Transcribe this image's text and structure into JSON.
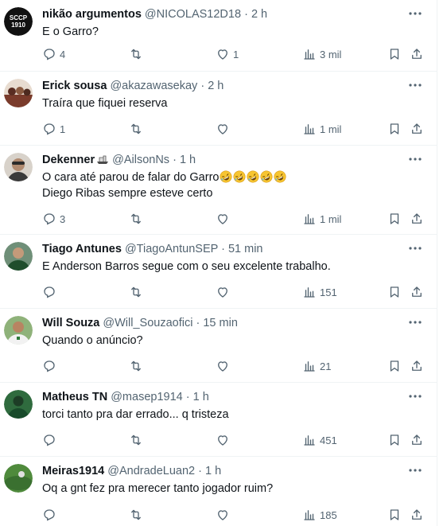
{
  "tweets": [
    {
      "name": "nikão argumentos",
      "handle": "@NICOLAS12D18",
      "sep": "·",
      "time": "2 h",
      "avatar_text": "SCCP\n1910",
      "avatar_color": "#111111",
      "lines": [
        "E o Garro?"
      ],
      "replies": "4",
      "retweets": "",
      "likes": "1",
      "views": "3 mil"
    },
    {
      "name": "Erick sousa",
      "handle": "@akazawasekay",
      "sep": "·",
      "time": "2 h",
      "avatar_color": "#7a3b2b",
      "lines": [
        "Traíra que fiquei reserva"
      ],
      "replies": "1",
      "retweets": "",
      "likes": "",
      "views": "1 mil"
    },
    {
      "name": "Dekenner",
      "handle": "@AilsonNs",
      "sep": "·",
      "time": "1 h",
      "avatar_color": "#c9b8a8",
      "lines": [
        "O cara até parou de falar do Garro",
        "Diego Ribas sempre esteve certo"
      ],
      "emoji_count": 5,
      "replies": "3",
      "retweets": "",
      "likes": "",
      "views": "1 mil"
    },
    {
      "name": "Tiago Antunes",
      "handle": "@TiagoAntunSEP",
      "sep": "·",
      "time": "51 min",
      "avatar_color": "#2f5e3a",
      "lines": [
        "E Anderson Barros segue com o seu excelente trabalho."
      ],
      "replies": "",
      "retweets": "",
      "likes": "",
      "views": "151"
    },
    {
      "name": "Will Souza",
      "handle": "@Will_Souzaofici",
      "sep": "·",
      "time": "15 min",
      "avatar_color": "#3f7a3a",
      "lines": [
        "Quando o anúncio?"
      ],
      "replies": "",
      "retweets": "",
      "likes": "",
      "views": "21"
    },
    {
      "name": "Matheus TN",
      "handle": "@masep1914",
      "sep": "·",
      "time": "1 h",
      "avatar_color": "#1f5c33",
      "lines": [
        "torci tanto pra dar errado... q tristeza"
      ],
      "replies": "",
      "retweets": "",
      "likes": "",
      "views": "451"
    },
    {
      "name": "Meiras1914",
      "handle": "@AndradeLuan2",
      "sep": "·",
      "time": "1 h",
      "avatar_color": "#3d7d32",
      "lines": [
        "Oq a gnt fez pra merecer tanto jogador ruim?"
      ],
      "replies": "",
      "retweets": "",
      "likes": "",
      "views": "185"
    }
  ],
  "colors": {
    "text": "#0f1419",
    "muted": "#536471",
    "divider": "#eff3f4"
  }
}
